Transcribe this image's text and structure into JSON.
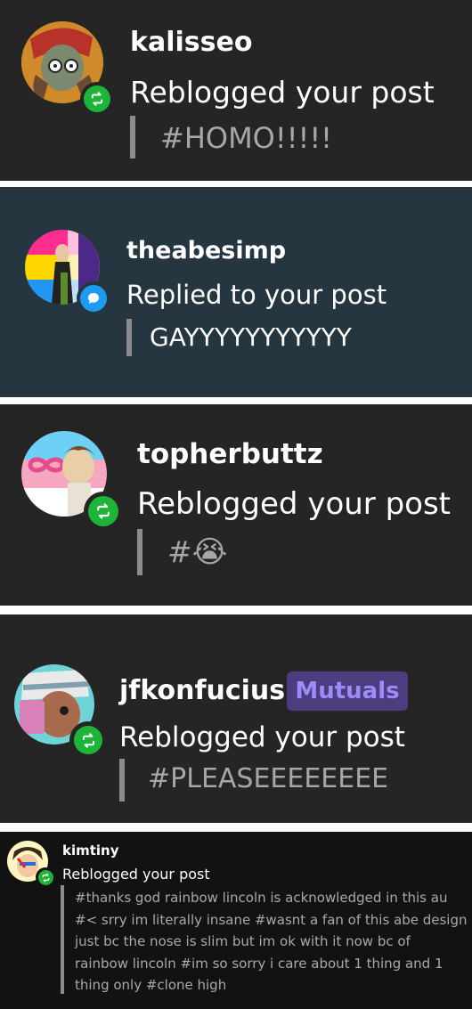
{
  "notifications": [
    {
      "username": "kalisseo",
      "action": "Reblogged your post",
      "content": "#HOMO!!!!!",
      "badge": "reblog-icon"
    },
    {
      "username": "theabesimp",
      "action": "Replied to your post",
      "content": "GAYYYYYYYYYYY",
      "badge": "reply-icon"
    },
    {
      "username": "topherbuttz",
      "action": "Reblogged your post",
      "content": "#",
      "emoji": "😭",
      "badge": "reblog-icon"
    },
    {
      "username": "jfkonfucius",
      "tag": "Mutuals",
      "action": "Reblogged your post",
      "content": "#PLEASEEEEEEEE",
      "badge": "reblog-icon"
    },
    {
      "username": "kimtiny",
      "action": "Reblogged your post",
      "content_lines": [
        "#thanks god rainbow lincoln is acknowledged in this au",
        "#< srry im literally insane #wasnt a fan of this abe design",
        "just bc the nose is slim but im ok with it now bc of",
        "rainbow lincoln #im so sorry i care about 1 thing and 1",
        "thing only #clone high"
      ],
      "badge": "reblog-icon"
    }
  ],
  "colors": {
    "reblog_green": "#1cb538",
    "reply_blue": "#1d9bf0",
    "mutual_bg": "#4d3d80",
    "mutual_text": "#9c8cf5"
  }
}
